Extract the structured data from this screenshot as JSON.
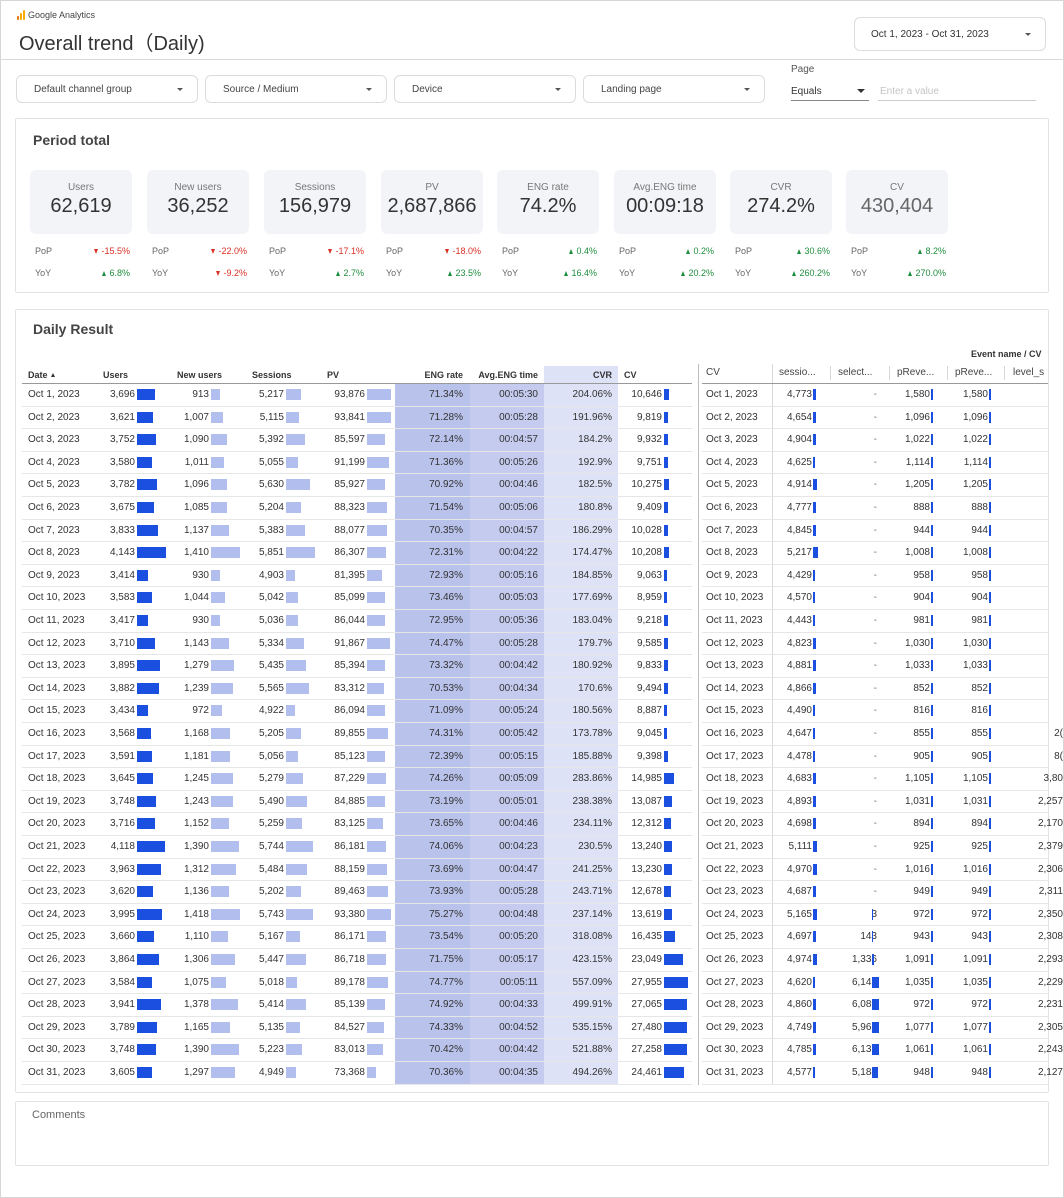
{
  "brand": "Google Analytics",
  "title": "Overall trend（Daily)",
  "date_range": "Oct 1, 2023 - Oct 31, 2023",
  "filters": [
    "Default channel group",
    "Source / Medium",
    "Device",
    "Landing page"
  ],
  "page_filter": {
    "label": "Page",
    "operator": "Equals",
    "placeholder": "Enter a value"
  },
  "period_total": {
    "title": "Period total",
    "kpis": [
      {
        "label": "Users",
        "value": "62,619",
        "pop": "-15.5%",
        "pop_dir": "down",
        "yoy": "6.8%",
        "yoy_dir": "up"
      },
      {
        "label": "New users",
        "value": "36,252",
        "pop": "-22.0%",
        "pop_dir": "down",
        "yoy": "-9.2%",
        "yoy_dir": "down"
      },
      {
        "label": "Sessions",
        "value": "156,979",
        "pop": "-17.1%",
        "pop_dir": "down",
        "yoy": "2.7%",
        "yoy_dir": "up"
      },
      {
        "label": "PV",
        "value": "2,687,866",
        "pop": "-18.0%",
        "pop_dir": "down",
        "yoy": "23.5%",
        "yoy_dir": "up"
      },
      {
        "label": "ENG rate",
        "value": "74.2%",
        "pop": "0.4%",
        "pop_dir": "up",
        "yoy": "16.4%",
        "yoy_dir": "up"
      },
      {
        "label": "Avg.ENG time",
        "value": "00:09:18",
        "pop": "0.2%",
        "pop_dir": "up",
        "yoy": "20.2%",
        "yoy_dir": "up"
      },
      {
        "label": "CVR",
        "value": "274.2%",
        "pop": "30.6%",
        "pop_dir": "up",
        "yoy": "260.2%",
        "yoy_dir": "up"
      },
      {
        "label": "CV",
        "value": "430,404",
        "pop": "8.2%",
        "pop_dir": "up",
        "yoy": "270.0%",
        "yoy_dir": "up"
      }
    ],
    "pop_label": "PoP",
    "yoy_label": "YoY"
  },
  "daily_result": {
    "title": "Daily Result",
    "headers": [
      "Date",
      "Users",
      "New users",
      "Sessions",
      "PV",
      "ENG rate",
      "Avg.ENG time",
      "CVR",
      "CV"
    ],
    "rows": [
      [
        "Oct 1, 2023",
        "3,696",
        "913",
        "5,217",
        "93,876",
        "71.34%",
        "00:05:30",
        "204.06%",
        "10,646"
      ],
      [
        "Oct 2, 2023",
        "3,621",
        "1,007",
        "5,115",
        "93,841",
        "71.28%",
        "00:05:28",
        "191.96%",
        "9,819"
      ],
      [
        "Oct 3, 2023",
        "3,752",
        "1,090",
        "5,392",
        "85,597",
        "72.14%",
        "00:04:57",
        "184.2%",
        "9,932"
      ],
      [
        "Oct 4, 2023",
        "3,580",
        "1,011",
        "5,055",
        "91,199",
        "71.36%",
        "00:05:26",
        "192.9%",
        "9,751"
      ],
      [
        "Oct 5, 2023",
        "3,782",
        "1,096",
        "5,630",
        "85,927",
        "70.92%",
        "00:04:46",
        "182.5%",
        "10,275"
      ],
      [
        "Oct 6, 2023",
        "3,675",
        "1,085",
        "5,204",
        "88,323",
        "71.54%",
        "00:05:06",
        "180.8%",
        "9,409"
      ],
      [
        "Oct 7, 2023",
        "3,833",
        "1,137",
        "5,383",
        "88,077",
        "70.35%",
        "00:04:57",
        "186.29%",
        "10,028"
      ],
      [
        "Oct 8, 2023",
        "4,143",
        "1,410",
        "5,851",
        "86,307",
        "72.31%",
        "00:04:22",
        "174.47%",
        "10,208"
      ],
      [
        "Oct 9, 2023",
        "3,414",
        "930",
        "4,903",
        "81,395",
        "72.93%",
        "00:05:16",
        "184.85%",
        "9,063"
      ],
      [
        "Oct 10, 2023",
        "3,583",
        "1,044",
        "5,042",
        "85,099",
        "73.46%",
        "00:05:03",
        "177.69%",
        "8,959"
      ],
      [
        "Oct 11, 2023",
        "3,417",
        "930",
        "5,036",
        "86,044",
        "72.95%",
        "00:05:36",
        "183.04%",
        "9,218"
      ],
      [
        "Oct 12, 2023",
        "3,710",
        "1,143",
        "5,334",
        "91,867",
        "74.47%",
        "00:05:28",
        "179.7%",
        "9,585"
      ],
      [
        "Oct 13, 2023",
        "3,895",
        "1,279",
        "5,435",
        "85,394",
        "73.32%",
        "00:04:42",
        "180.92%",
        "9,833"
      ],
      [
        "Oct 14, 2023",
        "3,882",
        "1,239",
        "5,565",
        "83,312",
        "70.53%",
        "00:04:34",
        "170.6%",
        "9,494"
      ],
      [
        "Oct 15, 2023",
        "3,434",
        "972",
        "4,922",
        "86,094",
        "71.09%",
        "00:05:24",
        "180.56%",
        "8,887"
      ],
      [
        "Oct 16, 2023",
        "3,568",
        "1,168",
        "5,205",
        "89,855",
        "74.31%",
        "00:05:42",
        "173.78%",
        "9,045"
      ],
      [
        "Oct 17, 2023",
        "3,591",
        "1,181",
        "5,056",
        "85,123",
        "72.39%",
        "00:05:15",
        "185.88%",
        "9,398"
      ],
      [
        "Oct 18, 2023",
        "3,645",
        "1,245",
        "5,279",
        "87,229",
        "74.26%",
        "00:05:09",
        "283.86%",
        "14,985"
      ],
      [
        "Oct 19, 2023",
        "3,748",
        "1,243",
        "5,490",
        "84,885",
        "73.19%",
        "00:05:01",
        "238.38%",
        "13,087"
      ],
      [
        "Oct 20, 2023",
        "3,716",
        "1,152",
        "5,259",
        "83,125",
        "73.65%",
        "00:04:46",
        "234.11%",
        "12,312"
      ],
      [
        "Oct 21, 2023",
        "4,118",
        "1,390",
        "5,744",
        "86,181",
        "74.06%",
        "00:04:23",
        "230.5%",
        "13,240"
      ],
      [
        "Oct 22, 2023",
        "3,963",
        "1,312",
        "5,484",
        "88,159",
        "73.69%",
        "00:04:47",
        "241.25%",
        "13,230"
      ],
      [
        "Oct 23, 2023",
        "3,620",
        "1,136",
        "5,202",
        "89,463",
        "73.93%",
        "00:05:28",
        "243.71%",
        "12,678"
      ],
      [
        "Oct 24, 2023",
        "3,995",
        "1,418",
        "5,743",
        "93,380",
        "75.27%",
        "00:04:48",
        "237.14%",
        "13,619"
      ],
      [
        "Oct 25, 2023",
        "3,660",
        "1,110",
        "5,167",
        "86,171",
        "73.54%",
        "00:05:20",
        "318.08%",
        "16,435"
      ],
      [
        "Oct 26, 2023",
        "3,864",
        "1,306",
        "5,447",
        "86,718",
        "71.75%",
        "00:05:17",
        "423.15%",
        "23,049"
      ],
      [
        "Oct 27, 2023",
        "3,584",
        "1,075",
        "5,018",
        "89,178",
        "74.77%",
        "00:05:11",
        "557.09%",
        "27,955"
      ],
      [
        "Oct 28, 2023",
        "3,941",
        "1,378",
        "5,414",
        "85,139",
        "74.92%",
        "00:04:33",
        "499.91%",
        "27,065"
      ],
      [
        "Oct 29, 2023",
        "3,789",
        "1,165",
        "5,135",
        "84,527",
        "74.33%",
        "00:04:52",
        "535.15%",
        "27,480"
      ],
      [
        "Oct 30, 2023",
        "3,748",
        "1,390",
        "5,223",
        "83,013",
        "70.42%",
        "00:04:42",
        "521.88%",
        "27,258"
      ],
      [
        "Oct 31, 2023",
        "3,605",
        "1,297",
        "4,949",
        "73,368",
        "70.36%",
        "00:04:35",
        "494.26%",
        "24,461"
      ]
    ]
  },
  "cv_table": {
    "group_header": "Event name / CV",
    "headers": [
      "CV",
      "sessio...",
      "select...",
      "pReve...",
      "pReve...",
      "level_s"
    ],
    "rows": [
      [
        "Oct 1, 2023",
        "4,773",
        "-",
        "1,580",
        "1,580",
        ""
      ],
      [
        "Oct 2, 2023",
        "4,654",
        "-",
        "1,096",
        "1,096",
        ""
      ],
      [
        "Oct 3, 2023",
        "4,904",
        "-",
        "1,022",
        "1,022",
        ""
      ],
      [
        "Oct 4, 2023",
        "4,625",
        "-",
        "1,114",
        "1,114",
        ""
      ],
      [
        "Oct 5, 2023",
        "4,914",
        "-",
        "1,205",
        "1,205",
        ""
      ],
      [
        "Oct 6, 2023",
        "4,777",
        "-",
        "888",
        "888",
        ""
      ],
      [
        "Oct 7, 2023",
        "4,845",
        "-",
        "944",
        "944",
        ""
      ],
      [
        "Oct 8, 2023",
        "5,217",
        "-",
        "1,008",
        "1,008",
        ""
      ],
      [
        "Oct 9, 2023",
        "4,429",
        "-",
        "958",
        "958",
        ""
      ],
      [
        "Oct 10, 2023",
        "4,570",
        "-",
        "904",
        "904",
        ""
      ],
      [
        "Oct 11, 2023",
        "4,443",
        "-",
        "981",
        "981",
        ""
      ],
      [
        "Oct 12, 2023",
        "4,823",
        "-",
        "1,030",
        "1,030",
        ""
      ],
      [
        "Oct 13, 2023",
        "4,881",
        "-",
        "1,033",
        "1,033",
        ""
      ],
      [
        "Oct 14, 2023",
        "4,866",
        "-",
        "852",
        "852",
        ""
      ],
      [
        "Oct 15, 2023",
        "4,490",
        "-",
        "816",
        "816",
        ""
      ],
      [
        "Oct 16, 2023",
        "4,647",
        "-",
        "855",
        "855",
        "2("
      ],
      [
        "Oct 17, 2023",
        "4,478",
        "-",
        "905",
        "905",
        "8("
      ],
      [
        "Oct 18, 2023",
        "4,683",
        "-",
        "1,105",
        "1,105",
        "3,80"
      ],
      [
        "Oct 19, 2023",
        "4,893",
        "-",
        "1,031",
        "1,031",
        "2,257"
      ],
      [
        "Oct 20, 2023",
        "4,698",
        "-",
        "894",
        "894",
        "2,170"
      ],
      [
        "Oct 21, 2023",
        "5,111",
        "-",
        "925",
        "925",
        "2,379"
      ],
      [
        "Oct 22, 2023",
        "4,970",
        "-",
        "1,016",
        "1,016",
        "2,306"
      ],
      [
        "Oct 23, 2023",
        "4,687",
        "-",
        "949",
        "949",
        "2,311"
      ],
      [
        "Oct 24, 2023",
        "5,165",
        "3",
        "972",
        "972",
        "2,350"
      ],
      [
        "Oct 25, 2023",
        "4,697",
        "143",
        "943",
        "943",
        "2,308"
      ],
      [
        "Oct 26, 2023",
        "4,974",
        "1,336",
        "1,091",
        "1,091",
        "2,293"
      ],
      [
        "Oct 27, 2023",
        "4,620",
        "6,141",
        "1,035",
        "1,035",
        "2,229"
      ],
      [
        "Oct 28, 2023",
        "4,860",
        "6,089",
        "972",
        "972",
        "2,231"
      ],
      [
        "Oct 29, 2023",
        "4,749",
        "5,961",
        "1,077",
        "1,077",
        "2,305"
      ],
      [
        "Oct 30, 2023",
        "4,785",
        "6,131",
        "1,061",
        "1,061",
        "2,243"
      ],
      [
        "Oct 31, 2023",
        "4,577",
        "5,188",
        "948",
        "948",
        "2,127"
      ]
    ]
  },
  "comments": {
    "label": "Comments"
  },
  "colors": {
    "bar_dark": "#1a4fe0",
    "bar_light": "#b2bfee",
    "eng_rate_bg": "#b9c2eb",
    "avg_eng_bg": "#c4cbee",
    "cvr_bg": "#dde2f6",
    "up": "#1e8e3e",
    "down": "#d93025"
  }
}
